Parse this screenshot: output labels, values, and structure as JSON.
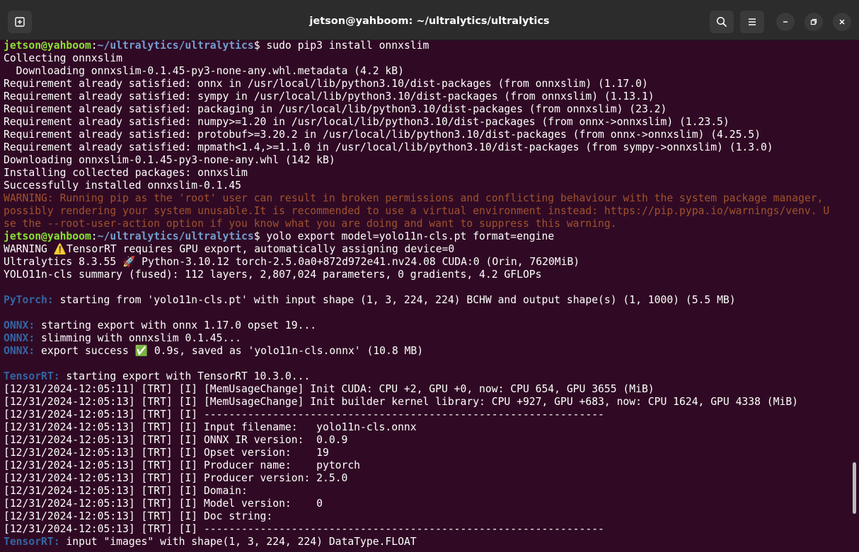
{
  "window": {
    "title": "jetson@yahboom: ~/ultralytics/ultralytics",
    "background_color": "#300a24",
    "titlebar_color": "#2c2c2c"
  },
  "titlebar_buttons": {
    "new_tab_icon": "new-tab-icon",
    "search_icon": "search-icon",
    "menu_icon": "hamburger-menu-icon",
    "minimize_icon": "minimize-icon",
    "restore_icon": "restore-icon",
    "close_icon": "close-icon"
  },
  "terminal": {
    "prompt_user": "jetson@yahboom",
    "prompt_path": "~/ultralytics/ultralytics",
    "line_01_cmd": "$ sudo pip3 install onnxslim",
    "line_02": "Collecting onnxslim",
    "line_03": "  Downloading onnxslim-0.1.45-py3-none-any.whl.metadata (4.2 kB)",
    "line_04": "Requirement already satisfied: onnx in /usr/local/lib/python3.10/dist-packages (from onnxslim) (1.17.0)",
    "line_05": "Requirement already satisfied: sympy in /usr/local/lib/python3.10/dist-packages (from onnxslim) (1.13.1)",
    "line_06": "Requirement already satisfied: packaging in /usr/local/lib/python3.10/dist-packages (from onnxslim) (23.2)",
    "line_07": "Requirement already satisfied: numpy>=1.20 in /usr/local/lib/python3.10/dist-packages (from onnx->onnxslim) (1.23.5)",
    "line_08": "Requirement already satisfied: protobuf>=3.20.2 in /usr/local/lib/python3.10/dist-packages (from onnx->onnxslim) (4.25.5)",
    "line_09": "Requirement already satisfied: mpmath<1.4,>=1.1.0 in /usr/local/lib/python3.10/dist-packages (from sympy->onnxslim) (1.3.0)",
    "line_10": "Downloading onnxslim-0.1.45-py3-none-any.whl (142 kB)",
    "line_11": "Installing collected packages: onnxslim",
    "line_12": "Successfully installed onnxslim-0.1.45",
    "line_13": "WARNING: Running pip as the 'root' user can result in broken permissions and conflicting behaviour with the system package manager,",
    "line_14": "possibly rendering your system unusable.It is recommended to use a virtual environment instead: https://pip.pypa.io/warnings/venv. U",
    "line_15": "se the --root-user-action option if you know what you are doing and want to suppress this warning.",
    "line_16_cmd": "$ yolo export model=yolo11n-cls.pt format=engine",
    "line_17": "WARNING ⚠️TensorRT requires GPU export, automatically assigning device=0",
    "line_18": "Ultralytics 8.3.55 🚀 Python-3.10.12 torch-2.5.0a0+872d972e41.nv24.08 CUDA:0 (Orin, 7620MiB)",
    "line_19": "YOLO11n-cls summary (fused): 112 layers, 2,807,024 parameters, 0 gradients, 4.2 GFLOPs",
    "pytorch_tag": "PyTorch:",
    "line_21": " starting from 'yolo11n-cls.pt' with input shape (1, 3, 224, 224) BCHW and output shape(s) (1, 1000) (5.5 MB)",
    "onnx_tag": "ONNX:",
    "line_23": " starting export with onnx 1.17.0 opset 19...",
    "line_24": " slimming with onnxslim 0.1.45...",
    "line_25": " export success ✅ 0.9s, saved as 'yolo11n-cls.onnx' (10.8 MB)",
    "tensorrt_tag": "TensorRT:",
    "line_27": " starting export with TensorRT 10.3.0...",
    "line_28": "[12/31/2024-12:05:11] [TRT] [I] [MemUsageChange] Init CUDA: CPU +2, GPU +0, now: CPU 654, GPU 3655 (MiB)",
    "line_29": "[12/31/2024-12:05:13] [TRT] [I] [MemUsageChange] Init builder kernel library: CPU +927, GPU +683, now: CPU 1624, GPU 4338 (MiB)",
    "line_30": "[12/31/2024-12:05:13] [TRT] [I] ----------------------------------------------------------------",
    "line_31": "[12/31/2024-12:05:13] [TRT] [I] Input filename:   yolo11n-cls.onnx",
    "line_32": "[12/31/2024-12:05:13] [TRT] [I] ONNX IR version:  0.0.9",
    "line_33": "[12/31/2024-12:05:13] [TRT] [I] Opset version:    19",
    "line_34": "[12/31/2024-12:05:13] [TRT] [I] Producer name:    pytorch",
    "line_35": "[12/31/2024-12:05:13] [TRT] [I] Producer version: 2.5.0",
    "line_36": "[12/31/2024-12:05:13] [TRT] [I] Domain:",
    "line_37": "[12/31/2024-12:05:13] [TRT] [I] Model version:    0",
    "line_38": "[12/31/2024-12:05:13] [TRT] [I] Doc string:",
    "line_39": "[12/31/2024-12:05:13] [TRT] [I] ----------------------------------------------------------------",
    "line_40": " input \"images\" with shape(1, 3, 224, 224) DataType.FLOAT"
  }
}
